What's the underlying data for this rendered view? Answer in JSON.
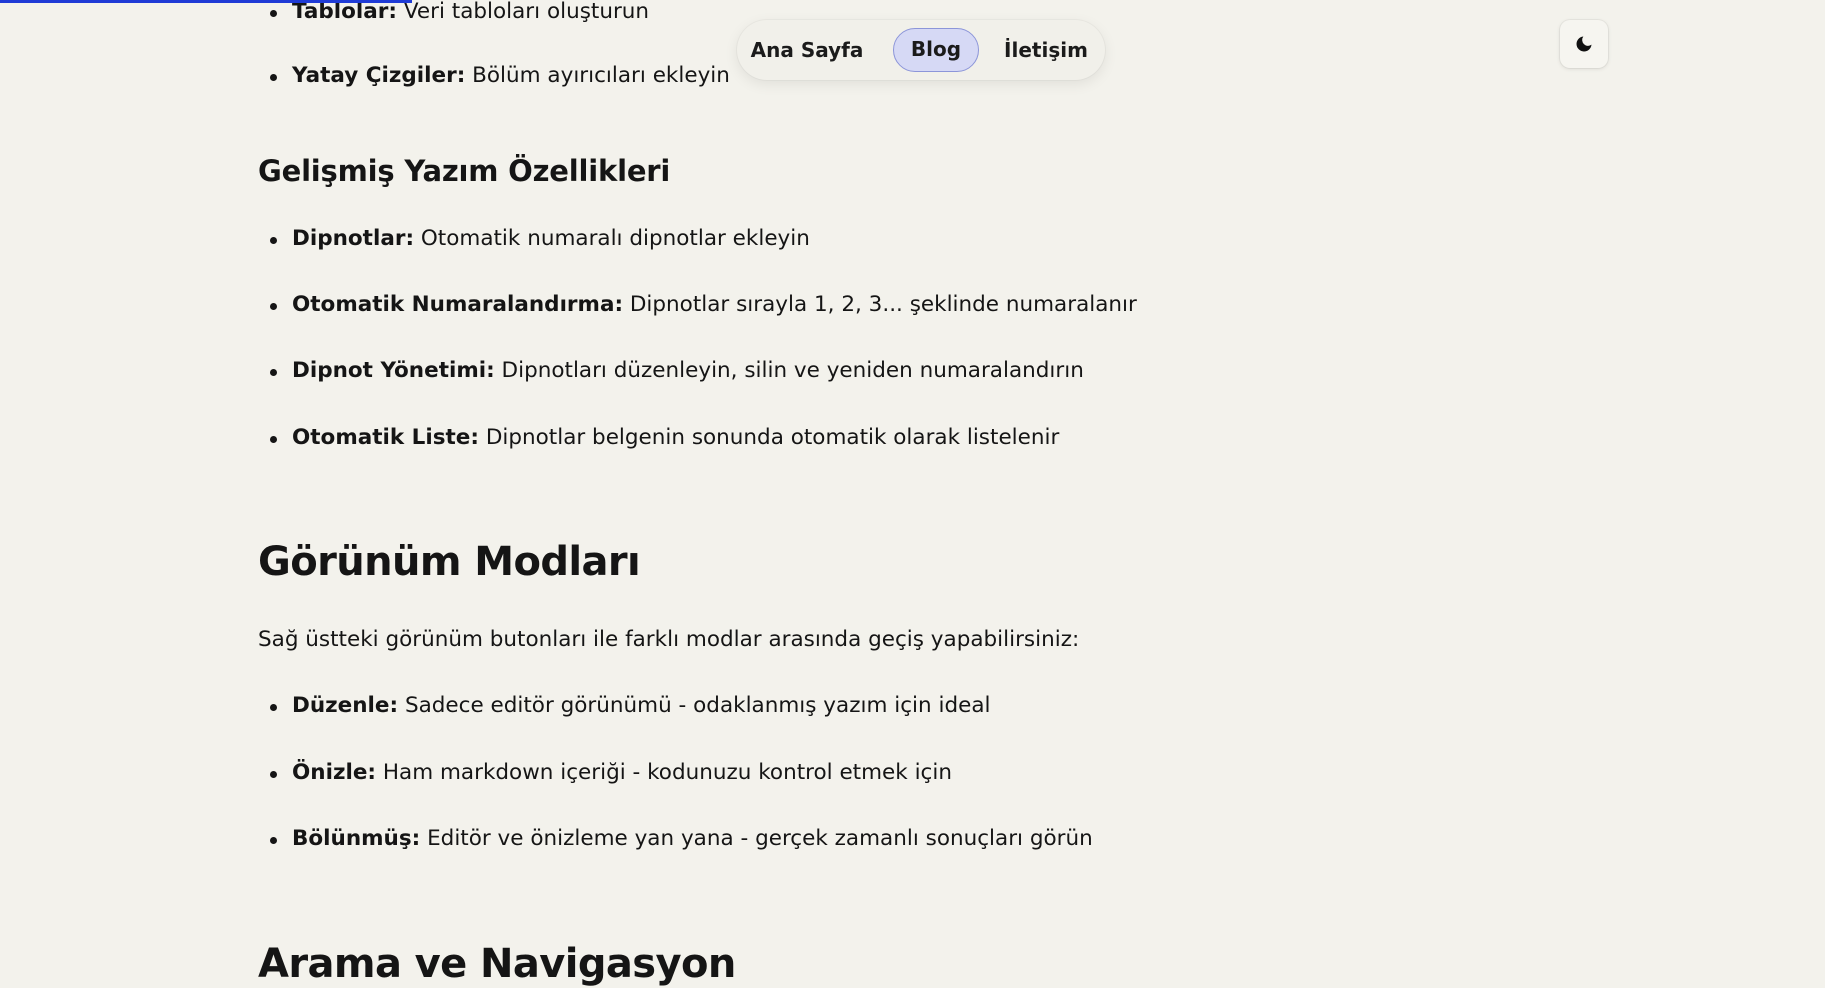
{
  "scroll_progress": 0.226,
  "nav": {
    "items": [
      {
        "label": "Ana Sayfa",
        "active": false
      },
      {
        "label": "Blog",
        "active": true
      },
      {
        "label": "İletişim",
        "active": false
      }
    ],
    "theme_toggle_icon": "moon-icon"
  },
  "colors": {
    "background": "#f3f2ec",
    "accent": "#1f3bd6",
    "active_pill": "#d6d9f5"
  },
  "article": {
    "top_list": [
      {
        "term": "Tablolar:",
        "desc": " Veri tabloları oluşturun"
      },
      {
        "term": "Yatay Çizgiler:",
        "desc": " Bölüm ayırıcıları ekleyin"
      }
    ],
    "advanced_heading": "Gelişmiş Yazım Özellikleri",
    "advanced_list": [
      {
        "term": "Dipnotlar:",
        "desc": " Otomatik numaralı dipnotlar ekleyin"
      },
      {
        "term": "Otomatik Numaralandırma:",
        "desc": " Dipnotlar sırayla 1, 2, 3... şeklinde numaralanır"
      },
      {
        "term": "Dipnot Yönetimi:",
        "desc": " Dipnotları düzenleyin, silin ve yeniden numaralandırın"
      },
      {
        "term": "Otomatik Liste:",
        "desc": " Dipnotlar belgenin sonunda otomatik olarak listelenir"
      }
    ],
    "view_modes_heading": "Görünüm Modları",
    "view_modes_intro": "Sağ üstteki görünüm butonları ile farklı modlar arasında geçiş yapabilirsiniz:",
    "view_modes_list": [
      {
        "term": "Düzenle:",
        "desc": " Sadece editör görünümü - odaklanmış yazım için ideal"
      },
      {
        "term": "Önizle:",
        "desc": " Ham markdown içeriği - kodunuzu kontrol etmek için"
      },
      {
        "term": "Bölünmüş:",
        "desc": " Editör ve önizleme yan yana - gerçek zamanlı sonuçları görün"
      }
    ],
    "search_heading": "Arama ve Navigasyon"
  }
}
